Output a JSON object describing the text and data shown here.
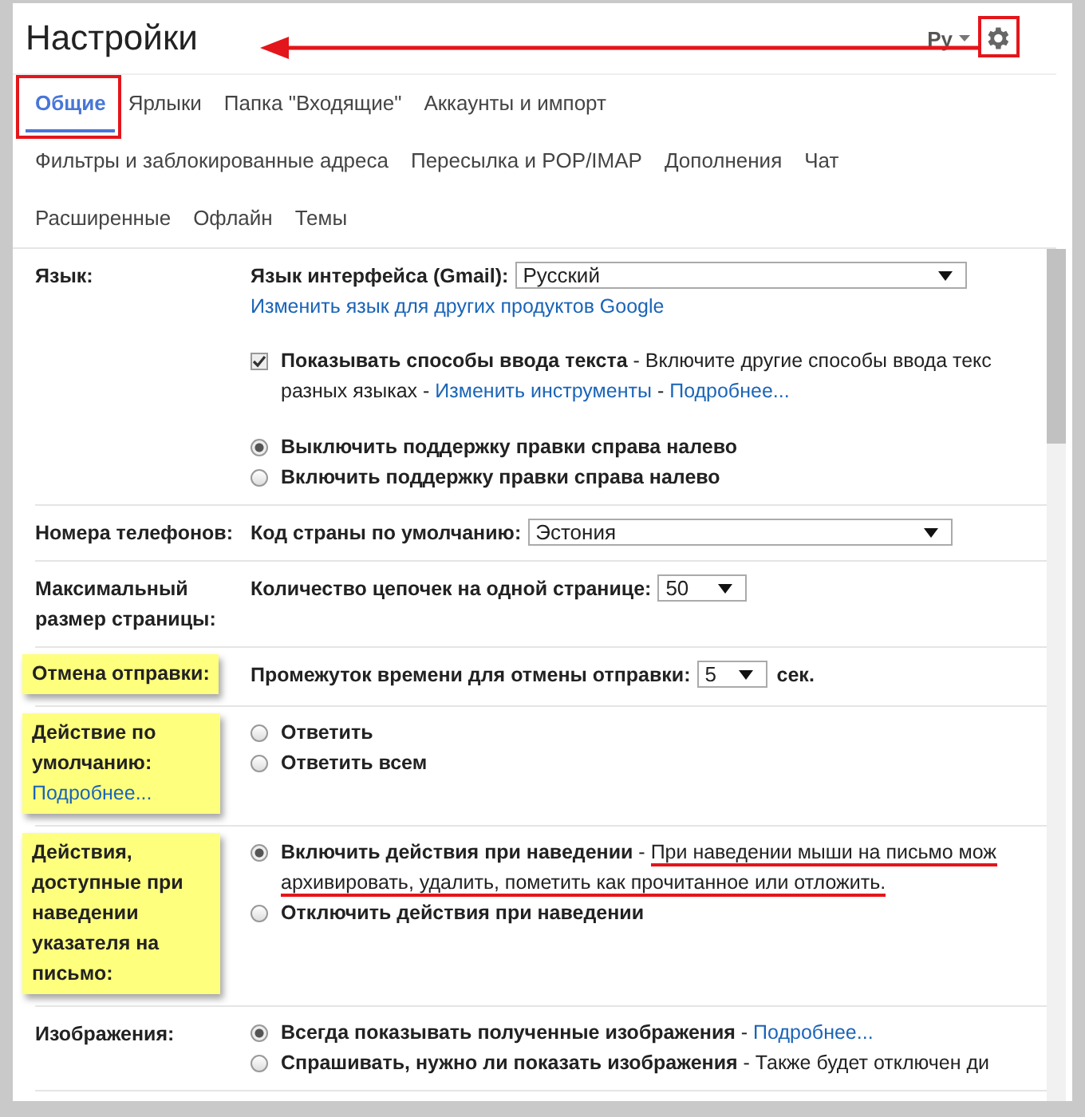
{
  "header": {
    "title": "Настройки",
    "language": "Ру",
    "annotation_arrow": true
  },
  "tab_rows": [
    [
      {
        "label": "Общие",
        "selected": true,
        "framed": true
      },
      {
        "label": "Ярлыки",
        "selected": false
      },
      {
        "label": "Папка \"Входящие\"",
        "selected": false
      },
      {
        "label": "Аккаунты и импорт",
        "selected": false
      }
    ],
    [
      {
        "label": "Фильтры и заблокированные адреса",
        "selected": false
      },
      {
        "label": "Пересылка и POP/IMAP",
        "selected": false
      },
      {
        "label": "Дополнения",
        "selected": false
      },
      {
        "label": "Чат",
        "selected": false
      }
    ],
    [
      {
        "label": "Расширенные",
        "selected": false
      },
      {
        "label": "Офлайн",
        "selected": false
      },
      {
        "label": "Темы",
        "selected": false
      }
    ]
  ],
  "sections": [
    {
      "label": "Язык:",
      "highlighted": false,
      "items": [
        {
          "kind": "select",
          "label": "Язык интерфейса (Gmail):",
          "value": "Русский"
        },
        {
          "kind": "link",
          "text": "Изменить язык для других продуктов Google"
        },
        {
          "kind": "gap"
        },
        {
          "kind": "checkbox",
          "checked": true,
          "lines": [
            [
              {
                "kind": "bold",
                "text": "Показывать способы ввода текста"
              },
              {
                "kind": "plain",
                "text": " - Включите другие способы ввода текс"
              }
            ],
            [
              {
                "kind": "plain",
                "text": "разных языках - "
              },
              {
                "kind": "link",
                "text": "Изменить инструменты"
              },
              {
                "kind": "plain",
                "text": " - "
              },
              {
                "kind": "link",
                "text": "Подробнее..."
              }
            ]
          ]
        },
        {
          "kind": "gap"
        },
        {
          "kind": "radio",
          "selected": true,
          "lines": [
            [
              {
                "kind": "bold",
                "text": "Выключить поддержку правки справа налево"
              }
            ]
          ]
        },
        {
          "kind": "radio",
          "selected": false,
          "lines": [
            [
              {
                "kind": "bold",
                "text": "Включить поддержку правки справа налево"
              }
            ]
          ]
        }
      ]
    },
    {
      "label": "Номера телефонов:",
      "highlighted": false,
      "items": [
        {
          "kind": "select",
          "label": "Код страны по умолчанию:",
          "value": "Эстония"
        }
      ]
    },
    {
      "label": "Максимальный размер страницы:",
      "highlighted": false,
      "items": [
        {
          "kind": "select",
          "label": "Количество цепочек на одной странице:",
          "value": "50"
        }
      ]
    },
    {
      "label": "Отмена отправки:",
      "highlighted": true,
      "items": [
        {
          "kind": "select",
          "label": "Промежуток времени для отмены отправки:",
          "value": "5",
          "suffix": "сек."
        }
      ]
    },
    {
      "label": "Действие по умолчанию:",
      "highlighted": true,
      "link": "Подробнее...",
      "items": [
        {
          "kind": "radio",
          "selected": false,
          "lines": [
            [
              {
                "kind": "bold",
                "text": "Ответить"
              }
            ]
          ]
        },
        {
          "kind": "radio",
          "selected": false,
          "lines": [
            [
              {
                "kind": "bold",
                "text": "Ответить всем"
              }
            ]
          ]
        }
      ]
    },
    {
      "label": "Действия, доступные при наведении указателя на письмо:",
      "highlighted": true,
      "items": [
        {
          "kind": "radio",
          "selected": true,
          "lines": [
            [
              {
                "kind": "bold",
                "text": "Включить действия при наведении"
              },
              {
                "kind": "plain",
                "text": " - "
              },
              {
                "kind": "underlined",
                "text": "При наведении мыши на письмо мож"
              }
            ],
            [
              {
                "kind": "underlined",
                "text": "архивировать, удалить, пометить как прочитанное или отложить."
              }
            ]
          ]
        },
        {
          "kind": "radio",
          "selected": false,
          "lines": [
            [
              {
                "kind": "bold",
                "text": "Отключить действия при наведении"
              }
            ]
          ]
        }
      ]
    },
    {
      "label": "Изображения:",
      "highlighted": false,
      "items": [
        {
          "kind": "radio",
          "selected": true,
          "lines": [
            [
              {
                "kind": "bold",
                "text": "Всегда показывать полученные изображения"
              },
              {
                "kind": "plain",
                "text": " - "
              },
              {
                "kind": "link",
                "text": "Подробнее..."
              }
            ]
          ]
        },
        {
          "kind": "radio",
          "selected": false,
          "lines": [
            [
              {
                "kind": "bold",
                "text": "Спрашивать, нужно ли показать изображения"
              },
              {
                "kind": "plain",
                "text": " - Также будет отключен ди"
              }
            ]
          ]
        }
      ]
    }
  ]
}
